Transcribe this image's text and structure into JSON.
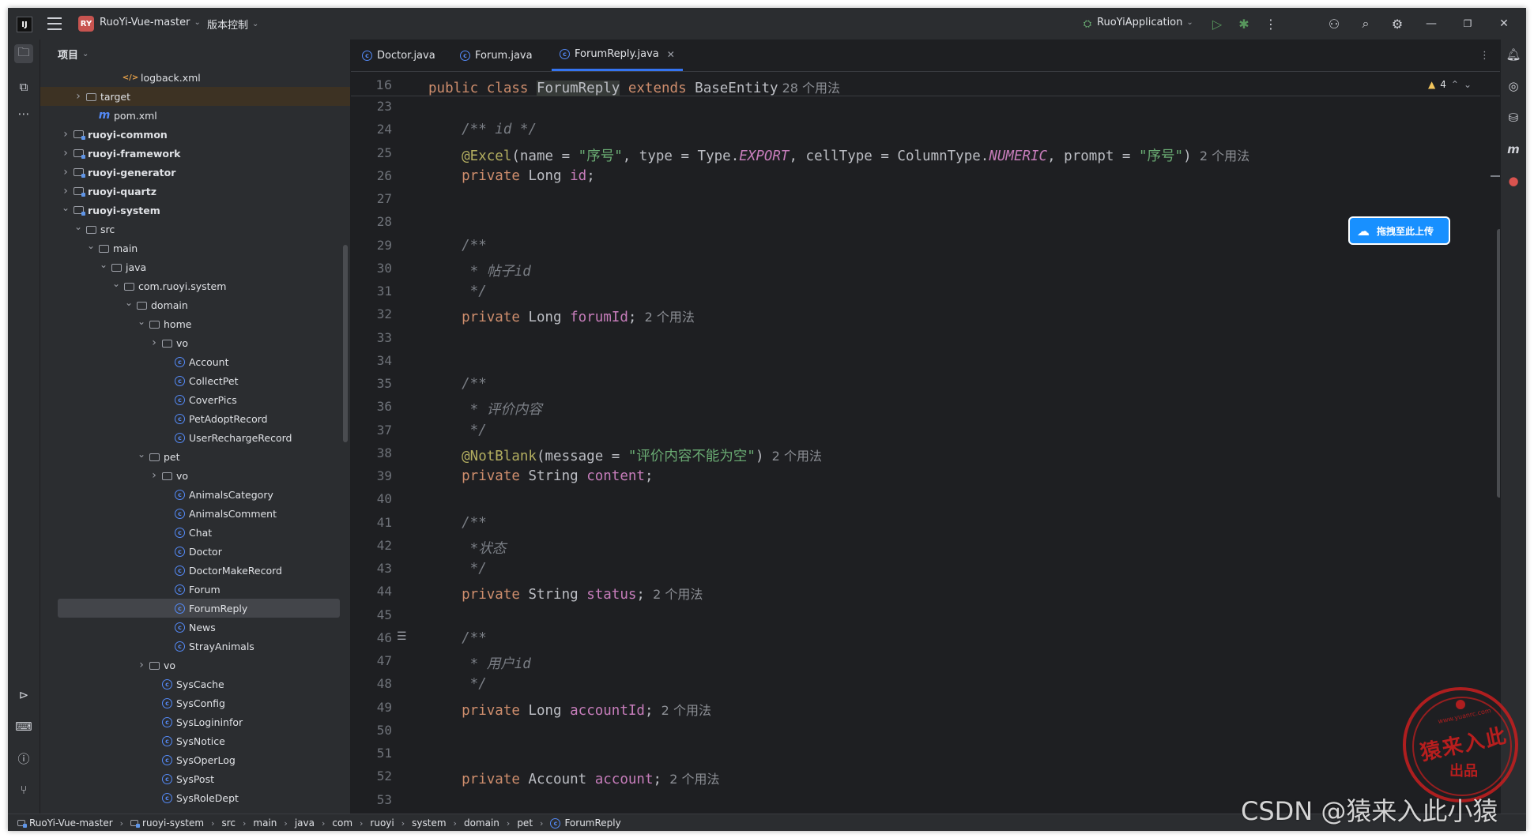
{
  "titlebar": {
    "project_badge": "RY",
    "project_name": "RuoYi-Vue-master",
    "vcs_label": "版本控制",
    "run_config": "RuoYiApplication"
  },
  "project_panel": {
    "title": "项目",
    "items": [
      {
        "label": "logback.xml",
        "type": "xml",
        "indent": 5,
        "arrow": ""
      },
      {
        "label": "target",
        "type": "folder",
        "indent": 2,
        "arrow": "right"
      },
      {
        "label": "pom.xml",
        "type": "maven",
        "indent": 3,
        "arrow": ""
      },
      {
        "label": "ruoyi-common",
        "type": "module",
        "indent": 1,
        "arrow": "right",
        "bold": true
      },
      {
        "label": "ruoyi-framework",
        "type": "module",
        "indent": 1,
        "arrow": "right",
        "bold": true
      },
      {
        "label": "ruoyi-generator",
        "type": "module",
        "indent": 1,
        "arrow": "right",
        "bold": true
      },
      {
        "label": "ruoyi-quartz",
        "type": "module",
        "indent": 1,
        "arrow": "right",
        "bold": true
      },
      {
        "label": "ruoyi-system",
        "type": "module",
        "indent": 1,
        "arrow": "down",
        "bold": true
      },
      {
        "label": "src",
        "type": "folder",
        "indent": 2,
        "arrow": "down"
      },
      {
        "label": "main",
        "type": "folder",
        "indent": 3,
        "arrow": "down"
      },
      {
        "label": "java",
        "type": "folder",
        "indent": 4,
        "arrow": "down"
      },
      {
        "label": "com.ruoyi.system",
        "type": "package",
        "indent": 5,
        "arrow": "down"
      },
      {
        "label": "domain",
        "type": "package",
        "indent": 6,
        "arrow": "down"
      },
      {
        "label": "home",
        "type": "package",
        "indent": 7,
        "arrow": "down"
      },
      {
        "label": "vo",
        "type": "package",
        "indent": 8,
        "arrow": "right"
      },
      {
        "label": "Account",
        "type": "class",
        "indent": 9,
        "arrow": ""
      },
      {
        "label": "CollectPet",
        "type": "class",
        "indent": 9,
        "arrow": ""
      },
      {
        "label": "CoverPics",
        "type": "class",
        "indent": 9,
        "arrow": ""
      },
      {
        "label": "PetAdoptRecord",
        "type": "class",
        "indent": 9,
        "arrow": ""
      },
      {
        "label": "UserRechargeRecord",
        "type": "class",
        "indent": 9,
        "arrow": ""
      },
      {
        "label": "pet",
        "type": "package",
        "indent": 7,
        "arrow": "down"
      },
      {
        "label": "vo",
        "type": "package",
        "indent": 8,
        "arrow": "right"
      },
      {
        "label": "AnimalsCategory",
        "type": "class",
        "indent": 9,
        "arrow": ""
      },
      {
        "label": "AnimalsComment",
        "type": "class",
        "indent": 9,
        "arrow": ""
      },
      {
        "label": "Chat",
        "type": "class",
        "indent": 9,
        "arrow": ""
      },
      {
        "label": "Doctor",
        "type": "class",
        "indent": 9,
        "arrow": ""
      },
      {
        "label": "DoctorMakeRecord",
        "type": "class",
        "indent": 9,
        "arrow": ""
      },
      {
        "label": "Forum",
        "type": "class",
        "indent": 9,
        "arrow": ""
      },
      {
        "label": "ForumReply",
        "type": "class",
        "indent": 9,
        "arrow": "",
        "selected": true
      },
      {
        "label": "News",
        "type": "class",
        "indent": 9,
        "arrow": ""
      },
      {
        "label": "StrayAnimals",
        "type": "class",
        "indent": 9,
        "arrow": ""
      },
      {
        "label": "vo",
        "type": "package",
        "indent": 7,
        "arrow": "right"
      },
      {
        "label": "SysCache",
        "type": "class",
        "indent": 8,
        "arrow": ""
      },
      {
        "label": "SysConfig",
        "type": "class",
        "indent": 8,
        "arrow": ""
      },
      {
        "label": "SysLogininfor",
        "type": "class",
        "indent": 8,
        "arrow": ""
      },
      {
        "label": "SysNotice",
        "type": "class",
        "indent": 8,
        "arrow": ""
      },
      {
        "label": "SysOperLog",
        "type": "class",
        "indent": 8,
        "arrow": ""
      },
      {
        "label": "SysPost",
        "type": "class",
        "indent": 8,
        "arrow": ""
      },
      {
        "label": "SysRoleDept",
        "type": "class",
        "indent": 8,
        "arrow": ""
      }
    ]
  },
  "tabs": [
    {
      "label": "Doctor.java",
      "active": false
    },
    {
      "label": "Forum.java",
      "active": false
    },
    {
      "label": "ForumReply.java",
      "active": true
    }
  ],
  "editor": {
    "warning_count": "4",
    "sticky": {
      "num": "16",
      "kw1": "public class ",
      "cls": "ForumReply",
      "kw2": " extends ",
      "base": "BaseEntity",
      "hint": "28 个用法"
    },
    "lines": [
      {
        "num": "23",
        "tokens": []
      },
      {
        "num": "24",
        "tokens": [
          {
            "t": "    /** ",
            "c": "cmt"
          },
          {
            "t": "id",
            "c": "cmt"
          },
          {
            "t": " */",
            "c": "cmt"
          }
        ]
      },
      {
        "num": "25",
        "tokens": [
          {
            "t": "    @Excel",
            "c": "ann"
          },
          {
            "t": "(name = ",
            "c": ""
          },
          {
            "t": "\"序号\"",
            "c": "str"
          },
          {
            "t": ", type = Type.",
            "c": ""
          },
          {
            "t": "EXPORT",
            "c": "ital"
          },
          {
            "t": ", cellType = ColumnType.",
            "c": ""
          },
          {
            "t": "NUMERIC",
            "c": "ital"
          },
          {
            "t": ", prompt = ",
            "c": ""
          },
          {
            "t": "\"序号\"",
            "c": "str"
          },
          {
            "t": ")",
            "c": ""
          },
          {
            "t": "  2 个用法",
            "c": "hint"
          }
        ]
      },
      {
        "num": "26",
        "tokens": [
          {
            "t": "    private ",
            "c": "kw"
          },
          {
            "t": "Long ",
            "c": ""
          },
          {
            "t": "id",
            "c": "fld"
          },
          {
            "t": ";",
            "c": ""
          }
        ]
      },
      {
        "num": "27",
        "tokens": []
      },
      {
        "num": "28",
        "tokens": []
      },
      {
        "num": "29",
        "tokens": [
          {
            "t": "    /**",
            "c": "cmt"
          }
        ]
      },
      {
        "num": "30",
        "tokens": [
          {
            "t": "     * 帖子id",
            "c": "cmt"
          }
        ]
      },
      {
        "num": "31",
        "tokens": [
          {
            "t": "     */",
            "c": "cmt"
          }
        ]
      },
      {
        "num": "32",
        "tokens": [
          {
            "t": "    private ",
            "c": "kw"
          },
          {
            "t": "Long ",
            "c": ""
          },
          {
            "t": "forumId",
            "c": "fld"
          },
          {
            "t": ";",
            "c": ""
          },
          {
            "t": "  2 个用法",
            "c": "hint"
          }
        ]
      },
      {
        "num": "33",
        "tokens": []
      },
      {
        "num": "34",
        "tokens": []
      },
      {
        "num": "35",
        "tokens": [
          {
            "t": "    /**",
            "c": "cmt"
          }
        ]
      },
      {
        "num": "36",
        "tokens": [
          {
            "t": "     * 评价内容",
            "c": "cmt"
          }
        ]
      },
      {
        "num": "37",
        "tokens": [
          {
            "t": "     */",
            "c": "cmt"
          }
        ]
      },
      {
        "num": "38",
        "tokens": [
          {
            "t": "    @NotBlank",
            "c": "ann"
          },
          {
            "t": "(message = ",
            "c": ""
          },
          {
            "t": "\"评价内容不能为空\"",
            "c": "str"
          },
          {
            "t": ")",
            "c": ""
          },
          {
            "t": "  2 个用法",
            "c": "hint"
          }
        ]
      },
      {
        "num": "39",
        "tokens": [
          {
            "t": "    private ",
            "c": "kw"
          },
          {
            "t": "String ",
            "c": ""
          },
          {
            "t": "content",
            "c": "fld"
          },
          {
            "t": ";",
            "c": ""
          }
        ]
      },
      {
        "num": "40",
        "tokens": []
      },
      {
        "num": "41",
        "tokens": [
          {
            "t": "    /**",
            "c": "cmt"
          }
        ]
      },
      {
        "num": "42",
        "tokens": [
          {
            "t": "     *状态",
            "c": "cmt"
          }
        ]
      },
      {
        "num": "43",
        "tokens": [
          {
            "t": "     */",
            "c": "cmt"
          }
        ]
      },
      {
        "num": "44",
        "tokens": [
          {
            "t": "    private ",
            "c": "kw"
          },
          {
            "t": "String ",
            "c": ""
          },
          {
            "t": "status",
            "c": "fld"
          },
          {
            "t": ";",
            "c": ""
          },
          {
            "t": "  2 个用法",
            "c": "hint"
          }
        ]
      },
      {
        "num": "45",
        "tokens": []
      },
      {
        "num": "46",
        "tokens": [
          {
            "t": "    /**",
            "c": "cmt"
          }
        ]
      },
      {
        "num": "47",
        "tokens": [
          {
            "t": "     * 用户id",
            "c": "cmt"
          }
        ]
      },
      {
        "num": "48",
        "tokens": [
          {
            "t": "     */",
            "c": "cmt"
          }
        ]
      },
      {
        "num": "49",
        "tokens": [
          {
            "t": "    private ",
            "c": "kw"
          },
          {
            "t": "Long ",
            "c": ""
          },
          {
            "t": "accountId",
            "c": "fld"
          },
          {
            "t": ";",
            "c": ""
          },
          {
            "t": "  2 个用法",
            "c": "hint"
          }
        ]
      },
      {
        "num": "50",
        "tokens": []
      },
      {
        "num": "51",
        "tokens": []
      },
      {
        "num": "52",
        "tokens": [
          {
            "t": "    private ",
            "c": "kw"
          },
          {
            "t": "Account ",
            "c": ""
          },
          {
            "t": "account",
            "c": "fld"
          },
          {
            "t": ";",
            "c": ""
          },
          {
            "t": "  2 个用法",
            "c": "hint"
          }
        ]
      },
      {
        "num": "53",
        "tokens": []
      }
    ]
  },
  "upload_button": "拖拽至此上传",
  "breadcrumb": [
    "RuoYi-Vue-master",
    "ruoyi-system",
    "src",
    "main",
    "java",
    "com",
    "ruoyi",
    "system",
    "domain",
    "pet",
    "ForumReply"
  ],
  "stamp": {
    "line1": "猿来入此",
    "line2": "出品",
    "url": "www.yuanrc.com"
  },
  "watermark": "CSDN @猿来入此小猿",
  "colors": {
    "accent": "#3574f0",
    "keyword": "#cf8e6d",
    "string": "#6aab73",
    "field": "#c77dbb",
    "annotation": "#b3ae60",
    "comment": "#7a7e85"
  }
}
